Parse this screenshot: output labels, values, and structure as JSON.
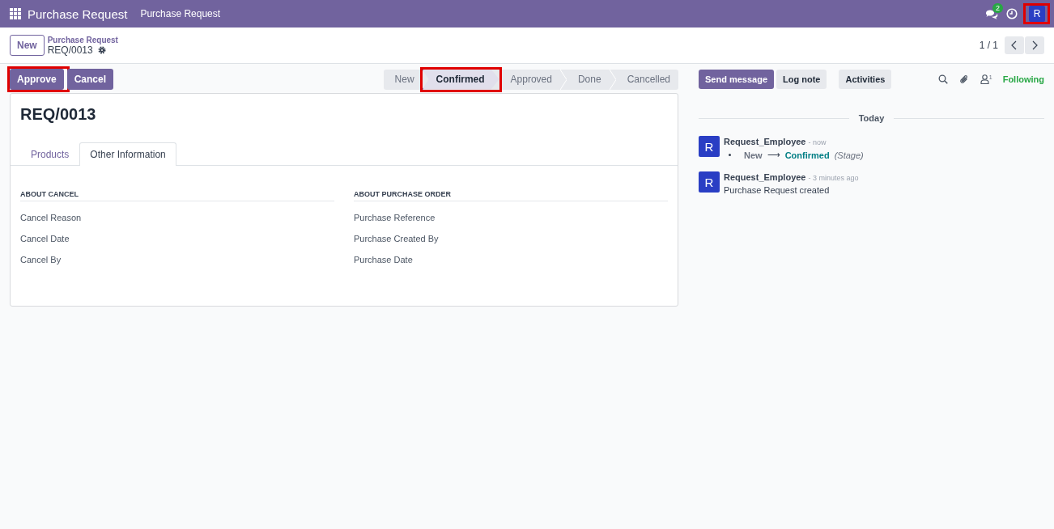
{
  "navbar": {
    "app_name": "Purchase Request",
    "menu": [
      {
        "label": "Purchase Request"
      }
    ],
    "messages_badge": "2",
    "avatar": {
      "initial": "R",
      "highlighted": true
    }
  },
  "breadcrumb": {
    "new_button": "New",
    "parent": "Purchase Request",
    "current": "REQ/0013"
  },
  "pager": {
    "value": "1 / 1"
  },
  "actions": [
    {
      "label": "Approve",
      "highlighted": true
    },
    {
      "label": "Cancel",
      "highlighted": false
    }
  ],
  "stages": [
    {
      "label": "New",
      "selected": false,
      "highlighted": false
    },
    {
      "label": "Confirmed",
      "selected": true,
      "highlighted": true
    },
    {
      "label": "Approved",
      "selected": false,
      "highlighted": false
    },
    {
      "label": "Done",
      "selected": false,
      "highlighted": false
    },
    {
      "label": "Cancelled",
      "selected": false,
      "highlighted": false
    }
  ],
  "form": {
    "title": "REQ/0013",
    "tabs": [
      {
        "label": "Products",
        "selected": false
      },
      {
        "label": "Other Information",
        "selected": true
      }
    ],
    "groups": [
      {
        "title": "ABOUT CANCEL",
        "fields": [
          "Cancel Reason",
          "Cancel Date",
          "Cancel By"
        ]
      },
      {
        "title": "ABOUT PURCHASE ORDER",
        "fields": [
          "Purchase Reference",
          "Purchase Created By",
          "Purchase Date"
        ]
      }
    ]
  },
  "chatter": {
    "buttons": [
      {
        "label": "Send message",
        "kind": "primary"
      },
      {
        "label": "Log note",
        "kind": "secondary"
      },
      {
        "label": "Activities",
        "kind": "secondary"
      }
    ],
    "followers_count": "1",
    "follow_label": "Following",
    "date_separator": "Today",
    "messages": [
      {
        "avatar": "R",
        "author": "Request_Employee",
        "time": "- now",
        "kind": "tracking",
        "old_value": "New",
        "arrow": "⟶",
        "new_value": "Confirmed",
        "field": "(Stage)"
      },
      {
        "avatar": "R",
        "author": "Request_Employee",
        "time": "- 3 minutes ago",
        "kind": "text",
        "body": "Purchase Request created"
      }
    ]
  }
}
